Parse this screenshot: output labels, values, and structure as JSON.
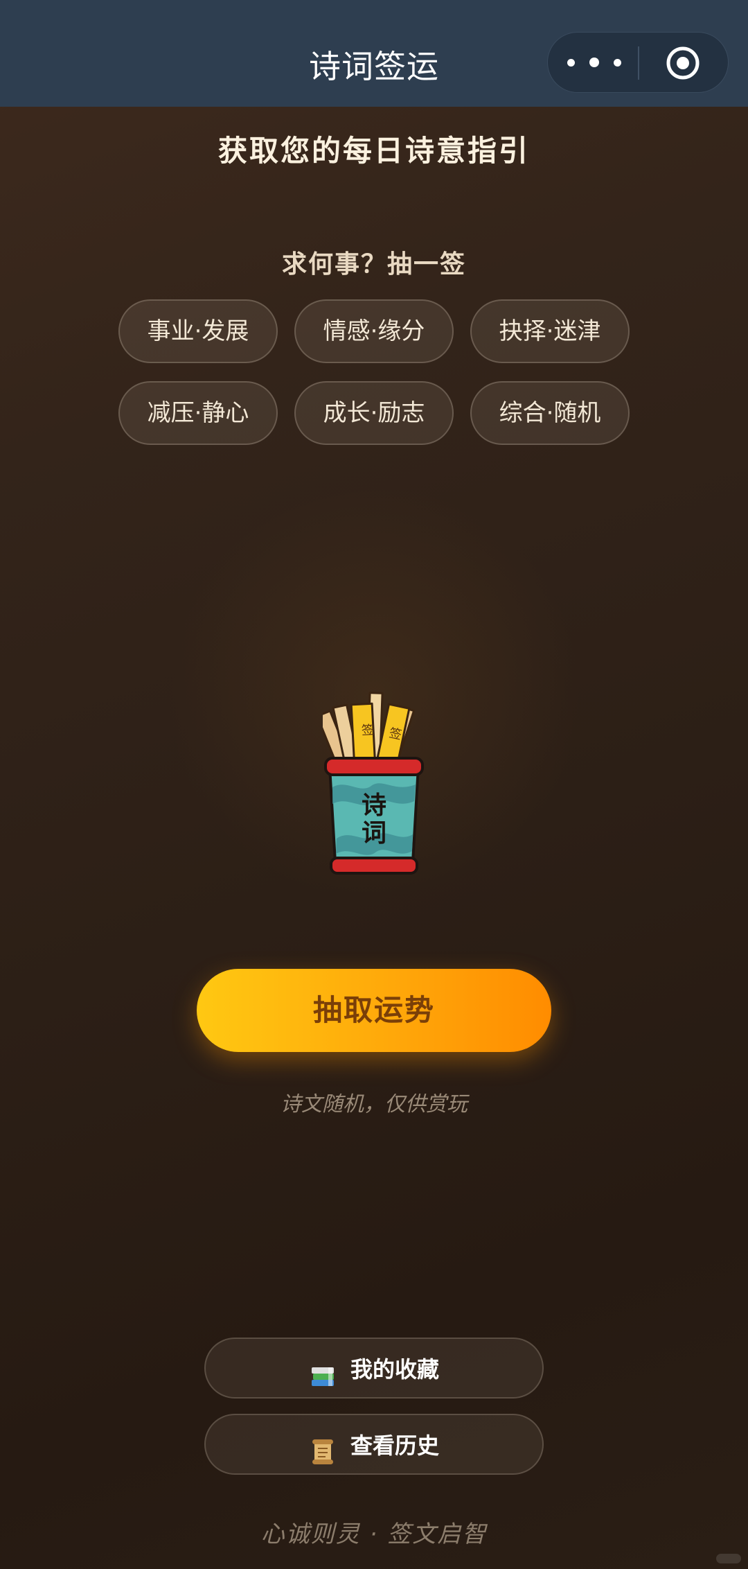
{
  "navbar": {
    "title": "诗词签运"
  },
  "headline": "获取您的每日诗意指引",
  "prompt": "求何事？抽一签",
  "categories": [
    {
      "label": "事业·发展"
    },
    {
      "label": "情感·缘分"
    },
    {
      "label": "抉择·迷津"
    },
    {
      "label": "减压·静心"
    },
    {
      "label": "成长·励志"
    },
    {
      "label": "综合·随机"
    }
  ],
  "illustration": {
    "pot_text_1": "诗",
    "pot_text_2": "词",
    "stick_text": "签"
  },
  "cta": {
    "label": "抽取运势"
  },
  "note": "诗文随机，仅供赏玩",
  "buttons": {
    "favorites_label": "我的收藏",
    "favorites_icon": "books-icon",
    "history_label": "查看历史",
    "history_icon": "scroll-icon"
  },
  "footer": "心诚则灵 · 签文启智",
  "colors": {
    "navbar": "#2e3e50",
    "cta_start": "#ffc812",
    "cta_end": "#ff8c00",
    "cta_text": "#7a3f08",
    "background": "#2c1f16"
  }
}
